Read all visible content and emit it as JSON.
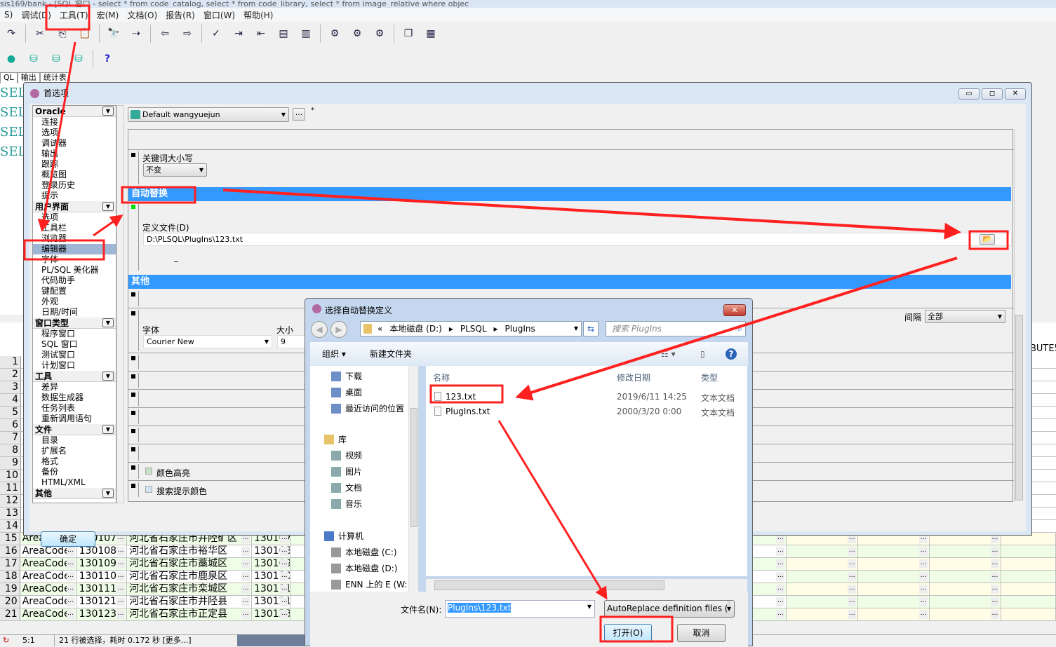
{
  "app": {
    "title": "sis169/bank - [SQL 窗口 - select * from code_catalog, select * from code_library, select * from image_relative where objec",
    "menu": [
      "S)",
      "调试(D)",
      "工具(T)",
      "宏(M)",
      "文档(O)",
      "报告(R)",
      "窗口(W)",
      "帮助(H)"
    ],
    "toolbar_icons": [
      "redo-icon",
      "cut-icon",
      "copy-icon",
      "paste-icon",
      "find-icon",
      "find-next-icon",
      "import-icon",
      "export-icon",
      "check-icon",
      "indent-icon",
      "unindent-icon",
      "comment-icon",
      "uncomment-icon",
      "compile-icon",
      "step-icon",
      "run-icon",
      "windows-icon",
      "tile-icon"
    ],
    "toolbar2_icons": [
      "bulb-icon",
      "sql-db-icon",
      "find-db-icon",
      "disconnect-db-icon",
      "help-icon"
    ],
    "help_glyph": "?",
    "tabs": [
      "QL",
      "输出",
      "统计表"
    ],
    "editor_lines": [
      "SEL",
      "SEL",
      "SEL",
      "SEL"
    ],
    "grid": {
      "row_numbers": [
        "1",
        "2",
        "3",
        "4",
        "5",
        "6",
        "7",
        "8",
        "9",
        "10",
        "11",
        "12",
        "13",
        "14"
      ],
      "column_partial": "BUTE5",
      "rows": [
        {
          "n": "15",
          "c1": "AreaCode",
          "c2": "130107",
          "c3": "河北省石家庄市井陉矿区",
          "c4": "130107"
        },
        {
          "n": "16",
          "c1": "AreaCode",
          "c2": "130108",
          "c3": "河北省石家庄市裕华区",
          "c4": "130108"
        },
        {
          "n": "17",
          "c1": "AreaCode",
          "c2": "130109",
          "c3": "河北省石家庄市藁城区",
          "c4": "130109"
        },
        {
          "n": "18",
          "c1": "AreaCode",
          "c2": "130110",
          "c3": "河北省石家庄市鹿泉区",
          "c4": "130110"
        },
        {
          "n": "19",
          "c1": "AreaCode",
          "c2": "130111",
          "c3": "河北省石家庄市栾城区",
          "c4": "130111"
        },
        {
          "n": "20",
          "c1": "AreaCode",
          "c2": "130121",
          "c3": "河北省石家庄市井陉县",
          "c4": "130121"
        },
        {
          "n": "21",
          "c1": "AreaCode",
          "c2": "130123",
          "c3": "河北省石家庄市正定县",
          "c4": "130123"
        }
      ]
    },
    "status": {
      "position": "5:1",
      "message": "21 行被选择，耗时 0.172 秒 [更多...]"
    }
  },
  "prefs": {
    "title": "首选项",
    "window_buttons": [
      "▭",
      "◻",
      "✕"
    ],
    "tree": [
      {
        "section": "Oracle",
        "items": [
          "连接",
          "选项",
          "调试器",
          "输出",
          "跟踪",
          "概览图",
          "登录历史",
          "提示"
        ]
      },
      {
        "section": "用户界面",
        "items": [
          "选项",
          "工具栏",
          "浏览器",
          "编辑器",
          "字体",
          "PL/SQL 美化器",
          "代码助手",
          "键配置",
          "外观",
          "日期/时间"
        ]
      },
      {
        "section": "窗口类型",
        "items": [
          "程序窗口",
          "SQL 窗口",
          "测试窗口",
          "计划窗口"
        ]
      },
      {
        "section": "工具",
        "items": [
          "差异",
          "数据生成器",
          "任务列表",
          "重新调用语句"
        ]
      },
      {
        "section": "文件",
        "items": [
          "目录",
          "扩展名",
          "格式",
          "备份",
          "HTML/XML"
        ]
      },
      {
        "section": "其他",
        "items": []
      }
    ],
    "selected_item": "编辑器",
    "profile": "Default wangyuejun",
    "profile_more": "...",
    "asterisk": "*",
    "keyword_case_label": "关键词大小写",
    "keyword_case_value": "不变",
    "autoreplace_header": "自动替换",
    "autoreplace_enabled": true,
    "definition_file_label": "定义文件(D)",
    "definition_file_value": "D:\\PLSQL\\PlugIns\\123.txt",
    "underscore": "_",
    "other_header": "其他",
    "font_label": "字体",
    "font_value": "Courier New",
    "size_label": "大小",
    "size_value": "9",
    "interval_label": "间隔",
    "interval_value": "全部",
    "color_highlight_label": "颜色高亮",
    "search_hint_color_label": "搜索提示颜色",
    "ok_button": "确定",
    "colors": {
      "band": "#3399ff",
      "selected": "#9fb6d4",
      "enabled": "#00dd00"
    }
  },
  "file_dialog": {
    "title": "选择自动替换定义",
    "breadcrumb": [
      "«",
      "本地磁盘 (D:)",
      "PLSQL",
      "PlugIns"
    ],
    "search_placeholder": "搜索 PlugIns",
    "organize": "组织 ▾",
    "new_folder": "新建文件夹",
    "nav": {
      "favorites": [
        "下载",
        "桌面",
        "最近访问的位置"
      ],
      "library_header": "库",
      "library": [
        "视频",
        "图片",
        "文档",
        "音乐"
      ],
      "computer_header": "计算机",
      "computer": [
        "本地磁盘 (C:)",
        "本地磁盘 (D:)",
        "ENN 上的 E (W:"
      ]
    },
    "columns": [
      "名称",
      "修改日期",
      "类型"
    ],
    "files": [
      {
        "name": "123.txt",
        "date": "2019/6/11 14:25",
        "type": "文本文档"
      },
      {
        "name": "PlugIns.txt",
        "date": "2000/3/20 0:00",
        "type": "文本文档"
      }
    ],
    "filename_label": "文件名(N):",
    "filename_value": "PlugIns\\123.txt",
    "filter_value": "AutoReplace definition files (",
    "open_button": "打开(O)",
    "cancel_button": "取消",
    "close_glyph": "✕"
  },
  "annotation_color": "#ff2020"
}
